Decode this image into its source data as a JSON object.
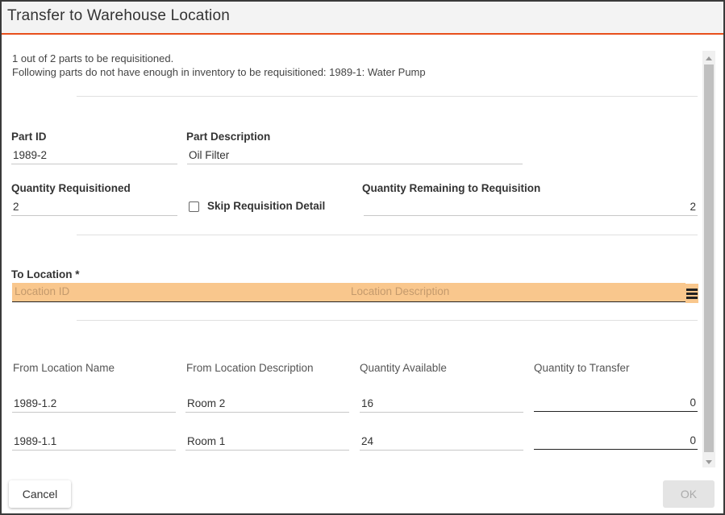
{
  "dialog": {
    "title": "Transfer to Warehouse Location",
    "accent_color": "#e8501c"
  },
  "messages": {
    "line1": "1 out of 2 parts to be requisitioned.",
    "line2": "Following parts do not have enough in inventory to be requisitioned: 1989-1: Water Pump"
  },
  "part": {
    "id_label": "Part ID",
    "id_value": "1989-2",
    "description_label": "Part Description",
    "description_value": "Oil Filter"
  },
  "quantities": {
    "requisitioned_label": "Quantity Requisitioned",
    "requisitioned_value": "2",
    "skip_label": "Skip Requisition Detail",
    "skip_checked": false,
    "remaining_label": "Quantity Remaining to Requisition",
    "remaining_value": "2"
  },
  "to_location": {
    "label": "To Location *",
    "id_placeholder": "Location ID",
    "description_placeholder": "Location Description",
    "highlight_color": "#f9c78d",
    "lookup_icon": "list-lookup-icon"
  },
  "from_table": {
    "headers": [
      "From Location Name",
      "From Location Description",
      "Quantity Available",
      "Quantity to Transfer"
    ],
    "rows": [
      {
        "name": "1989-1.2",
        "description": "Room 2",
        "available": "16",
        "transfer": "0"
      },
      {
        "name": "1989-1.1",
        "description": "Room 1",
        "available": "24",
        "transfer": "0"
      }
    ]
  },
  "footer": {
    "cancel_label": "Cancel",
    "ok_label": "OK",
    "ok_disabled": true
  }
}
